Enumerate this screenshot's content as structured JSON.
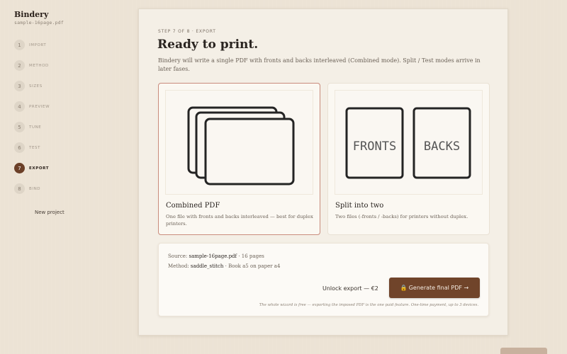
{
  "sidebar": {
    "brand": "Bindery",
    "file": "sample-16page.pdf",
    "steps": [
      {
        "num": "1",
        "label": "IMPORT"
      },
      {
        "num": "2",
        "label": "METHOD"
      },
      {
        "num": "3",
        "label": "SIZES"
      },
      {
        "num": "4",
        "label": "PREVIEW"
      },
      {
        "num": "5",
        "label": "TUNE"
      },
      {
        "num": "6",
        "label": "TEST"
      },
      {
        "num": "7",
        "label": "EXPORT"
      },
      {
        "num": "8",
        "label": "BIND"
      }
    ],
    "active_step": 7,
    "new_project": "New project"
  },
  "main": {
    "step_caption": "STEP 7 OF 8 · EXPORT",
    "title": "Ready to print.",
    "description": "Bindery will write a single PDF with fronts and backs interleaved (Combined mode). Split / Test modes arrive in later fases.",
    "cards": [
      {
        "title": "Combined PDF",
        "desc": "One file with fronts and backs interleaved — best for duplex printers.",
        "selected": true
      },
      {
        "title": "Split into two",
        "desc": "Two files (-fronts / -backs) for printers without duplex.",
        "selected": false,
        "preview_labels": [
          "FRONTS",
          "BACKS"
        ]
      }
    ],
    "summary": {
      "source_label": "Source:",
      "source_value": "sample-16page.pdf",
      "source_suffix": " · 16 pages",
      "method_label": "Method:",
      "method_value": "saddle_stitch",
      "method_suffix": " · Book a5 on paper a4",
      "unlock": "Unlock export — €2",
      "generate": "Generate final PDF →",
      "fine_print": "The whole wizard is free — exporting the imposed PDF is the one paid feature. One-time payment, up to 3 devices."
    }
  },
  "colors": {
    "accent": "#70442a",
    "selected_border": "#c98b7c",
    "background": "#ece3d5",
    "panel": "#f4efe6"
  }
}
